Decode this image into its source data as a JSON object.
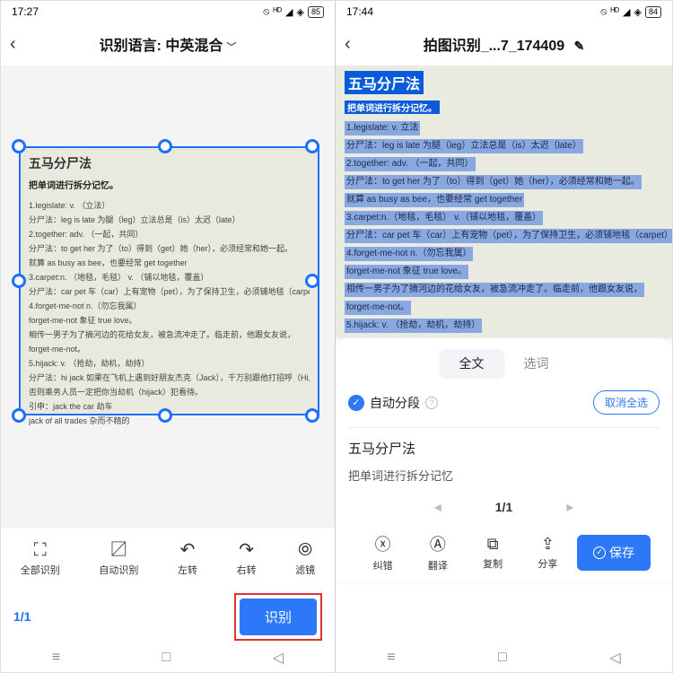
{
  "left": {
    "status": {
      "time": "17:27",
      "battery": "85"
    },
    "header": {
      "back": "‹",
      "title": "识别语言: 中英混合",
      "chevron": "﹀"
    },
    "image": {
      "title": "五马分尸法",
      "subtitle": "把单词进行拆分记忆。",
      "lines": [
        "1.legislate: v. （立法）",
        "分尸法：leg is late 为腿（leg）立法总是（is）太迟（late）",
        "2.together: adv. （一起，共同）",
        "分尸法：to get her 为了（to）得到（get）她（her），必须经常和她一起。",
        "就算 as busy as bee，也要经常 get together",
        "3.carpet:n. （地毯，毛毯） v. （铺以地毯，覆盖）",
        "分尸法：car pet 车（car）上有宠物（pet），为了保持卫生，必须铺地毯（carpet）",
        "4.forget-me-not n.（勿忘我属）",
        "forget-me-not 象征 true love。",
        "相传一男子为了摘河边的花给女友，被急流冲走了。临走前，他跟女友说，",
        "forget-me-not。",
        "5.hijack: v. （抢劫，劫机，劫持）",
        "分尸法：hi jack 如果在飞机上遇到好朋友杰克（Jack），千万别跟他打招呼（Hi,Jack），",
        "否则乘务人员一定把你当劫机（hijack）犯看待。",
        "引申：jack the car 劫车",
        "jack of all trades 杂而不精的"
      ]
    },
    "tools": {
      "full": "全部识别",
      "auto": "自动识别",
      "left": "左转",
      "right": "右转",
      "filter": "滤镜"
    },
    "page": "1/1",
    "recognize": "识别"
  },
  "right": {
    "status": {
      "time": "17:44",
      "battery": "84"
    },
    "header": {
      "back": "‹",
      "title": "拍图识别_...7_174409",
      "edit": "✎"
    },
    "highlighted": {
      "title": "五马分尸法",
      "subtitle": "把单词进行拆分记忆。",
      "lines": [
        "1.legislate: v. 立法",
        "分尸法：leg is late 为腿（leg）立法总是（is）太迟（late）",
        "2.together: adv. （一起，共同）",
        "分尸法：to get her 为了（to）得到（get）她（her），必须经常和她一起。",
        "就算 as busy as bee，也要经常 get together",
        "3.carpet:n.（地毯，毛毯） v.（铺以地毯，覆盖）",
        "分尸法：car pet 车（car）上有宠物（pet），为了保持卫生，必须铺地毯（carpet）",
        "4.forget-me-not n.（勿忘我属）",
        "forget-me-not 象征 true love。",
        "相传一男子为了摘河边的花给女友，被急流冲走了。临走前，他跟女友说，",
        "forget-me-not。",
        "5.hijack: v. （抢劫，劫机，劫持）"
      ]
    },
    "tabs": {
      "full": "全文",
      "word": "选词"
    },
    "autoseg": {
      "label": "自动分段",
      "deselect": "取消全选"
    },
    "preview": {
      "title": "五马分尸法",
      "sub": "把单词进行拆分记忆"
    },
    "pager": {
      "prev": "◂",
      "page": "1/1",
      "next": "▸"
    },
    "actions": {
      "correct": "纠错",
      "translate": "翻译",
      "copy": "复制",
      "share": "分享",
      "save": "保存"
    }
  }
}
